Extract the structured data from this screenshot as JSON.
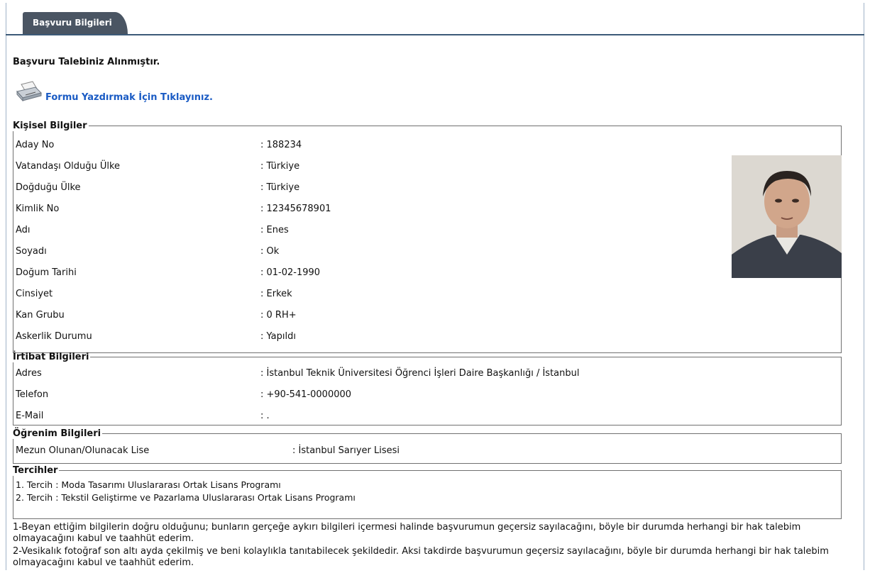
{
  "tab": {
    "label": "Başvuru Bilgileri"
  },
  "confirmation": "Başvuru Talebiniz Alınmıştır.",
  "print_link": "Formu Yazdırmak İçin Tıklayınız.",
  "personal": {
    "legend": "Kişisel Bilgiler",
    "rows": [
      {
        "label": "Aday No",
        "value": ": 188234"
      },
      {
        "label": "Vatandaşı Olduğu Ülke",
        "value": ": Türkiye"
      },
      {
        "label": "Doğduğu Ülke",
        "value": ": Türkiye"
      },
      {
        "label": "Kimlik No",
        "value": ": 12345678901"
      },
      {
        "label": "Adı",
        "value": ": Enes"
      },
      {
        "label": "Soyadı",
        "value": ": Ok"
      },
      {
        "label": "Doğum Tarihi",
        "value": ": 01-02-1990"
      },
      {
        "label": "Cinsiyet",
        "value": ": Erkek"
      },
      {
        "label": "Kan Grubu",
        "value": ": 0 RH+"
      },
      {
        "label": "Askerlik Durumu",
        "value": ": Yapıldı"
      }
    ]
  },
  "contact": {
    "legend": "İrtibat Bilgileri",
    "rows": [
      {
        "label": "Adres",
        "value": ": İstanbul Teknik Üniversitesi Öğrenci İşleri Daire Başkanlığı / İstanbul"
      },
      {
        "label": "Telefon",
        "value": ": +90-541-0000000"
      },
      {
        "label": "E-Mail",
        "value": ": ."
      }
    ]
  },
  "education": {
    "legend": "Öğrenim Bilgileri",
    "label": "Mezun Olunan/Olunacak Lise",
    "value": ": İstanbul Sarıyer Lisesi"
  },
  "preferences": {
    "legend": "Tercihler",
    "items": [
      "1. Tercih : Moda Tasarımı Uluslararası Ortak Lisans Programı",
      "2. Tercih : Tekstil Geliştirme ve Pazarlama Uluslararası Ortak Lisans Programı"
    ]
  },
  "declarations": [
    "1-Beyan ettiğim bilgilerin doğru olduğunu; bunların gerçeğe aykırı bilgileri içermesi halinde başvurumun geçersiz sayılacağını, böyle bir durumda herhangi bir hak talebim olmayacağını kabul ve taahhüt ederim.",
    "2-Vesikalık fotoğraf son altı ayda çekilmiş ve beni kolaylıkla tanıtabilecek şekildedir. Aksi takdirde başvurumun geçersiz sayılacağını, böyle bir durumda herhangi bir hak talebim olmayacağını kabul ve taahhüt ederim."
  ],
  "icons": {
    "print": "printer-icon",
    "photo": "applicant-photo"
  }
}
